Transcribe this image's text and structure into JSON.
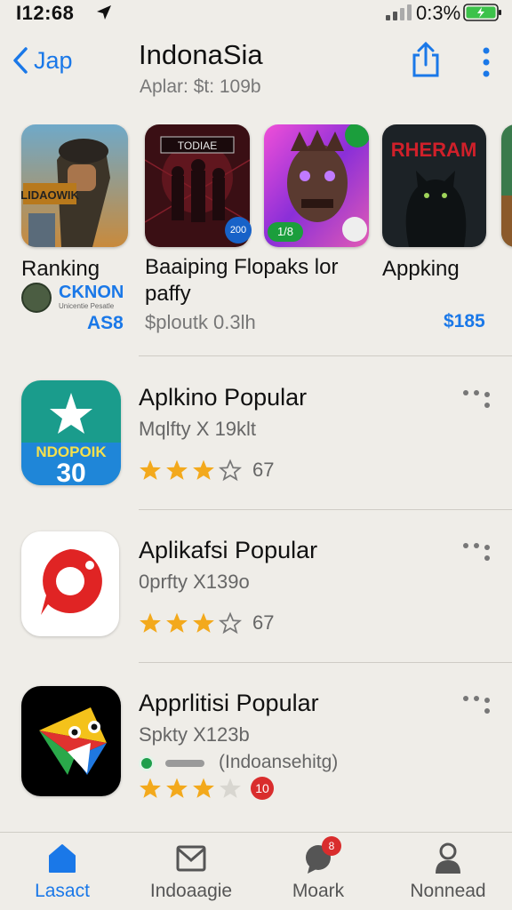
{
  "status_bar": {
    "time": "I12:68",
    "battery": "0:3%"
  },
  "header": {
    "back_label": "Jap",
    "title": "IndonaSia",
    "subtitle": "Aplar: $t: 109b"
  },
  "carousel": [
    {
      "title": "Ranking",
      "sub_line1": "CKNON",
      "sub_line2": "Unicentie Pesatle",
      "price": "AS8",
      "thumb_text": "LIDAOWIK"
    },
    {
      "title": "Baaiping Flopaks lor",
      "title2": "paffy",
      "sub": "$ploutk 0.3lh",
      "thumb_text": "TODIAE",
      "badge": "200"
    },
    {
      "title": "",
      "badge": "1/8"
    },
    {
      "title": "Appking",
      "price": "$185",
      "thumb_text": "RHERAM"
    }
  ],
  "list": [
    {
      "title": "Aplkino Popular",
      "sub": "Mqlfty X 19klt",
      "rating": 3,
      "count": "67",
      "icon_text_top": "NDOPOIK",
      "icon_text_bottom": "30"
    },
    {
      "title": "Aplikafsi Popular",
      "sub": "0prfty X139o",
      "rating": 3,
      "count": "67"
    },
    {
      "title": "Apprlitisi Popular",
      "sub": "Spkty X123b",
      "extra": "(Indoansehitg)",
      "rating": 3,
      "count": "10"
    }
  ],
  "tabs": [
    {
      "label": "Lasact",
      "icon": "home-icon",
      "active": true
    },
    {
      "label": "Indoaagie",
      "icon": "mail-icon",
      "active": false
    },
    {
      "label": "Moark",
      "icon": "chat-icon",
      "active": false,
      "badge": "8"
    },
    {
      "label": "Nonnead",
      "icon": "person-icon",
      "active": false
    }
  ],
  "colors": {
    "accent": "#1a78e8",
    "star": "#f3a91c",
    "background": "#efede8"
  }
}
